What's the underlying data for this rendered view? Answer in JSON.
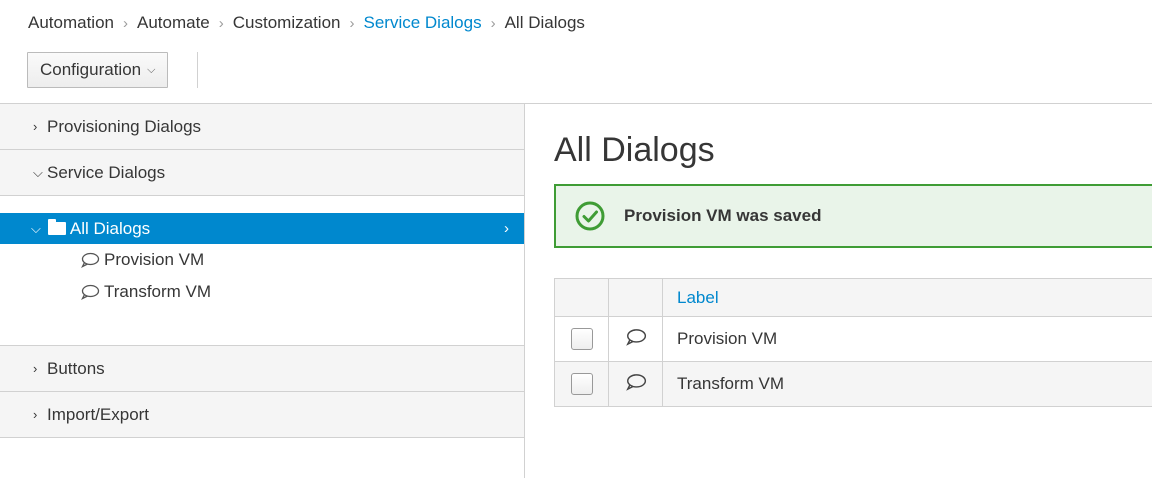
{
  "breadcrumb": {
    "items": [
      "Automation",
      "Automate",
      "Customization",
      "Service Dialogs",
      "All Dialogs"
    ],
    "separator": ">"
  },
  "toolbar": {
    "configuration_label": "Configuration"
  },
  "sidebar": {
    "accordions": [
      {
        "label": "Provisioning Dialogs",
        "expanded": false
      },
      {
        "label": "Service Dialogs",
        "expanded": true
      },
      {
        "label": "Buttons",
        "expanded": false
      },
      {
        "label": "Import/Export",
        "expanded": false
      }
    ],
    "tree": {
      "root_label": "All Dialogs",
      "children": [
        "Provision VM",
        "Transform VM"
      ]
    }
  },
  "main": {
    "title": "All Dialogs",
    "alert": {
      "type": "success",
      "message": "Provision VM was saved"
    },
    "table": {
      "header_label": "Label",
      "rows": [
        {
          "label": "Provision VM"
        },
        {
          "label": "Transform VM"
        }
      ]
    }
  },
  "colors": {
    "accent": "#0088ce",
    "success": "#3f9c35",
    "success_bg": "#e9f4e9"
  },
  "icons": {
    "collapsed": "chevron-right-icon",
    "expanded": "chevron-down-icon",
    "folder": "folder-icon",
    "dialog": "comment-bubble-icon",
    "success": "check-circle-icon"
  }
}
